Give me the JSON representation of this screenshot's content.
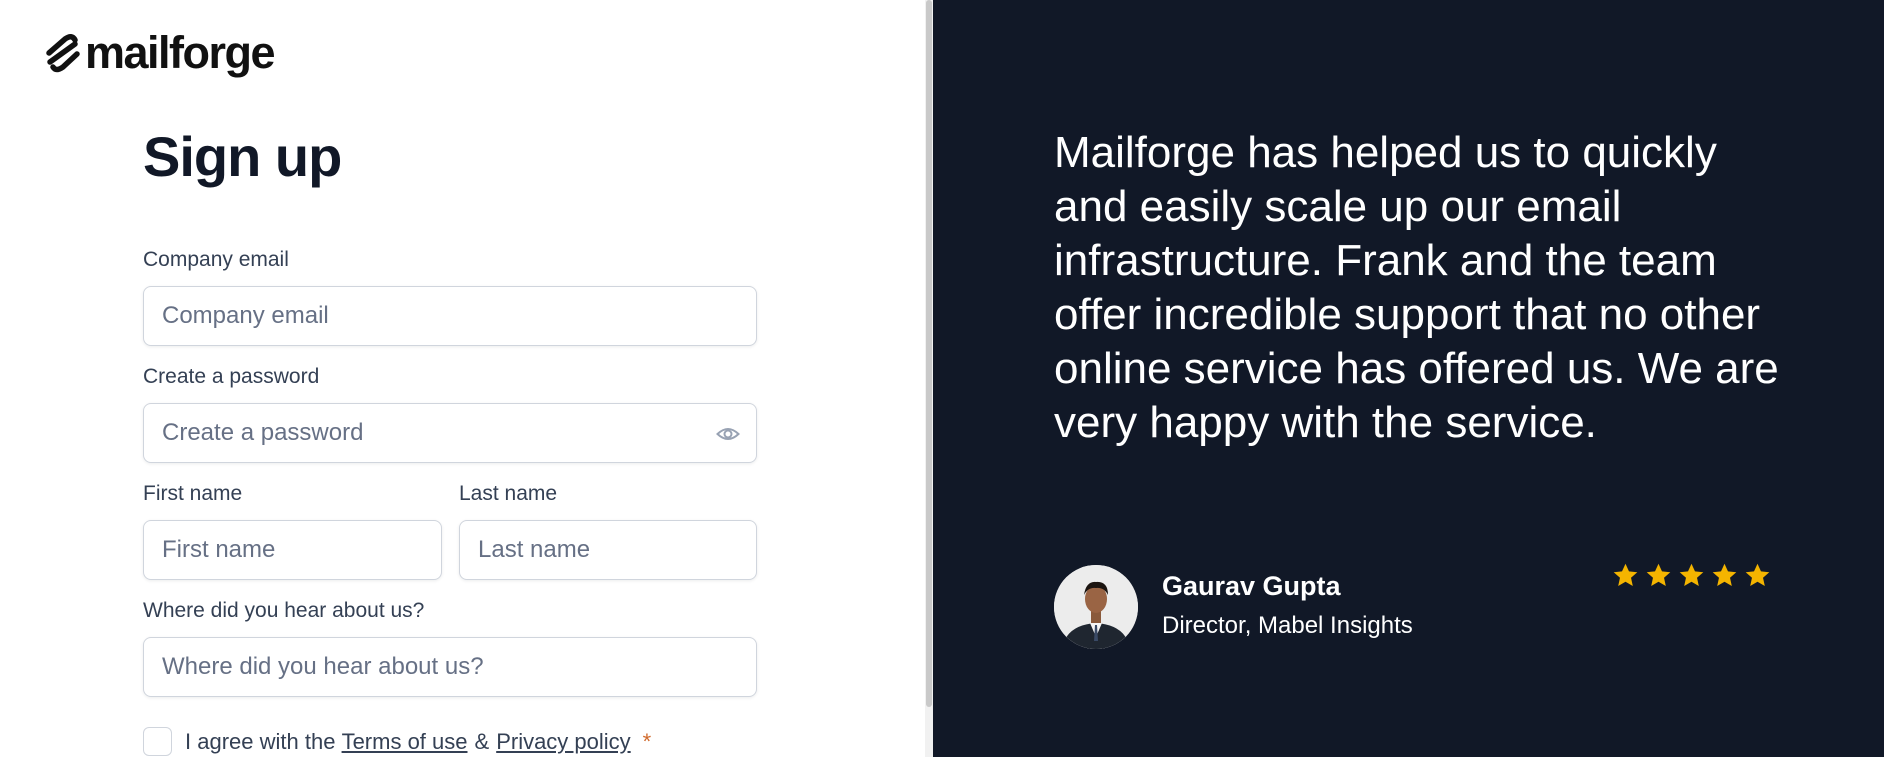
{
  "brand": {
    "name": "mailforge"
  },
  "form": {
    "title": "Sign up",
    "company_email": {
      "label": "Company email",
      "placeholder": "Company email"
    },
    "password": {
      "label": "Create a password",
      "placeholder": "Create a password"
    },
    "first_name": {
      "label": "First name",
      "placeholder": "First name"
    },
    "last_name": {
      "label": "Last name",
      "placeholder": "Last name"
    },
    "referral": {
      "label": "Where did you hear about us?",
      "placeholder": "Where did you hear about us?"
    },
    "agree": {
      "prefix": "I agree with the",
      "terms": "Terms of use",
      "separator": "&",
      "privacy": "Privacy policy",
      "required_mark": "*"
    }
  },
  "testimonial": {
    "quote": "Mailforge has helped us to quickly and easily scale up our email infrastructure. Frank and the team offer incredible support that no other online service has offered us. We are very happy with the service.",
    "author_name": "Gaurav Gupta",
    "author_role": "Director, Mabel Insights",
    "rating": 5,
    "star_color": "#f4b400"
  },
  "colors": {
    "panel_background": "#111827",
    "heading": "#111827",
    "required": "#d06a2c"
  }
}
